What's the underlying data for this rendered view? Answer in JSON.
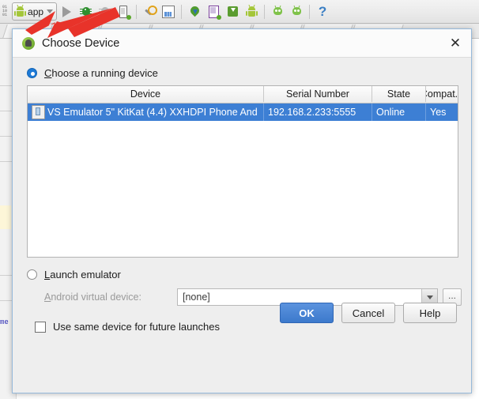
{
  "ide": {
    "toolbar": {
      "run_config_label": "app",
      "icons": [
        "binary-indicator-icon",
        "run-config-dropdown",
        "run-icon",
        "debug-icon",
        "attach-debugger-icon",
        "device-debug-icon",
        "sdk-manager-icon",
        "layout-inspector-icon",
        "location-icon",
        "device-monitor-icon",
        "sdk-download-icon",
        "avd-manager-icon",
        "alien-icon-1",
        "alien-icon-2",
        "help-icon"
      ]
    }
  },
  "dialog": {
    "title": "Choose Device",
    "title_icon": "android-avatar-icon",
    "close_label": "✕",
    "running_device": {
      "radio_label": "Choose a running device",
      "selected": true,
      "mnemonic": "C"
    },
    "table": {
      "columns": [
        "Device",
        "Serial Number",
        "State",
        "Compat..."
      ],
      "rows": [
        {
          "device": "VS Emulator 5\" KitKat (4.4) XXHDPI Phone And",
          "serial": "192.168.2.233:5555",
          "state": "Online",
          "compatible": "Yes",
          "selected": true,
          "icon": "phone-device-icon"
        }
      ]
    },
    "launch_emulator": {
      "radio_label": "Launch emulator",
      "selected": false,
      "mnemonic": "L"
    },
    "avd": {
      "label": "Android virtual device:",
      "value": "[none]",
      "mnemonic": "A",
      "browse_label": "...",
      "disabled": true
    },
    "future_launches": {
      "label": "Use same device for future launches",
      "checked": false
    },
    "buttons": {
      "ok": "OK",
      "cancel": "Cancel",
      "help": "Help"
    }
  },
  "annotation": {
    "arrow": "red-arrow-pointing-to-run-config",
    "color": "#e8332a"
  },
  "colors": {
    "selection_blue": "#3d7fd4",
    "primary_button": "#3c79cc",
    "dialog_bg": "#eeeeee",
    "dialog_border": "#96b9da",
    "radio_accent": "#1e7ad6",
    "android_green": "#a4c639"
  }
}
